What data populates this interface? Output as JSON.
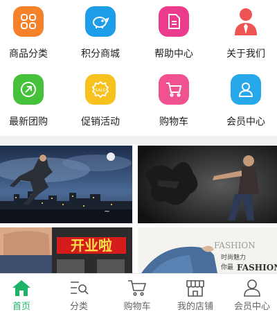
{
  "grid": {
    "items": [
      {
        "label": "商品分类",
        "icon": "category-grid-icon",
        "color": "#f5822a"
      },
      {
        "label": "积分商城",
        "icon": "piggy-bank-icon",
        "color": "#1e9de8"
      },
      {
        "label": "帮助中心",
        "icon": "document-help-icon",
        "color": "#ea3b8c"
      },
      {
        "label": "关于我们",
        "icon": "person-tie-icon",
        "color": "#ef5454"
      },
      {
        "label": "最新团购",
        "icon": "arrow-up-right-icon",
        "color": "#46c23a"
      },
      {
        "label": "促销活动",
        "icon": "sale-tag-icon",
        "color": "#f7c11e"
      },
      {
        "label": "购物车",
        "icon": "shopping-cart-icon",
        "color": "#f0528f"
      },
      {
        "label": "会员中心",
        "icon": "member-user-icon",
        "color": "#27a8ea"
      }
    ]
  },
  "banners": {
    "promo_text": "开业啦",
    "fashion_text_1": "FASHION",
    "fashion_text_2": "时尚魅力",
    "fashion_text_3": "你最",
    "fashion_text_4": "FASHION"
  },
  "tabbar": {
    "items": [
      {
        "label": "首页",
        "icon": "home-icon",
        "active": true
      },
      {
        "label": "分类",
        "icon": "category-list-icon",
        "active": false
      },
      {
        "label": "购物车",
        "icon": "cart-icon",
        "active": false
      },
      {
        "label": "我的店铺",
        "icon": "store-icon",
        "active": false
      },
      {
        "label": "会员中心",
        "icon": "user-icon",
        "active": false
      }
    ],
    "active_color": "#1fb36a"
  }
}
